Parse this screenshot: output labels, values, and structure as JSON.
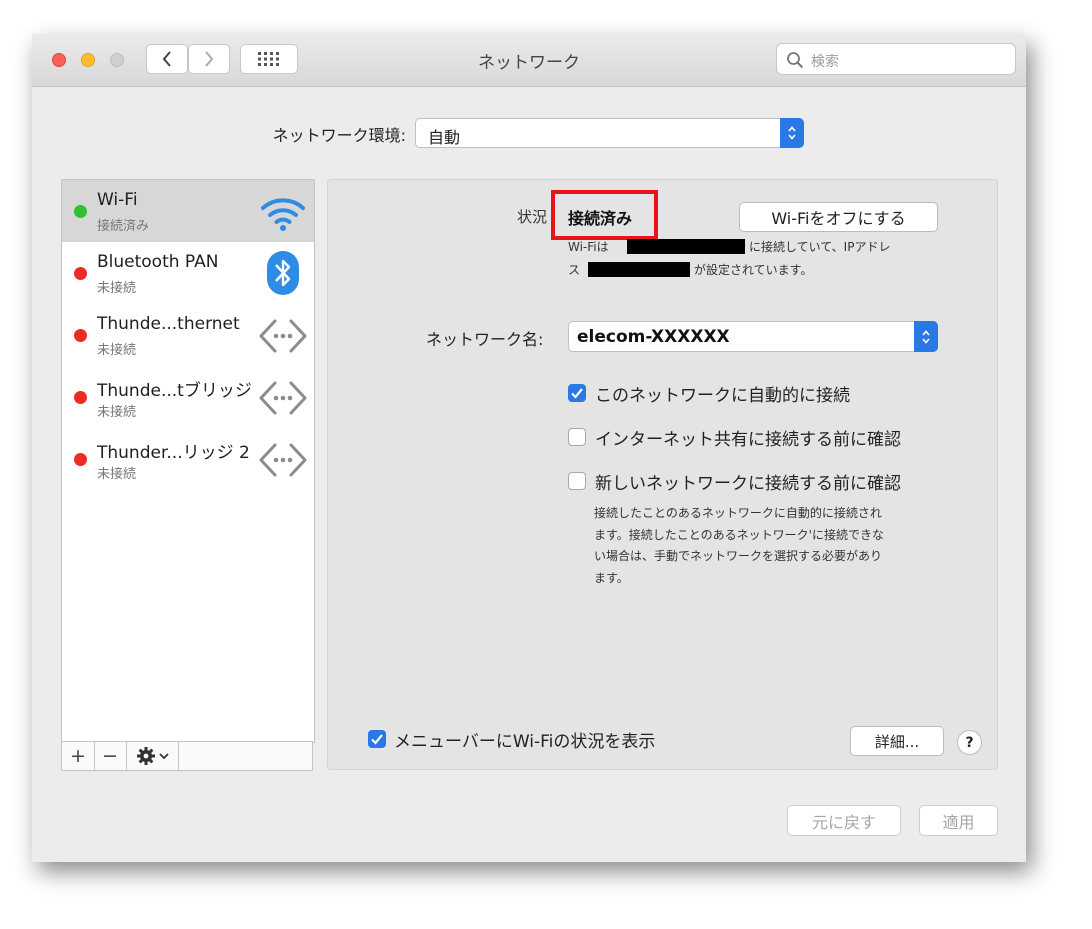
{
  "window": {
    "title": "ネットワーク",
    "search_placeholder": "検索"
  },
  "location": {
    "label": "ネットワーク環境:",
    "value": "自動"
  },
  "services": [
    {
      "name": "Wi-Fi",
      "status": "接続済み",
      "dot_color": "#2fc12f",
      "icon": "wifi-icon",
      "selected": true
    },
    {
      "name": "Bluetooth PAN",
      "status": "未接続",
      "dot_color": "#ee2a24",
      "icon": "bluetooth-icon"
    },
    {
      "name": "Thunde...thernet",
      "status": "未接続",
      "dot_color": "#ee2a24",
      "icon": "ethernet-arrows-icon"
    },
    {
      "name": "Thunde...tブリッジ",
      "status": "未接続",
      "dot_color": "#ee2a24",
      "icon": "ethernet-arrows-icon"
    },
    {
      "name": "Thunder...リッジ 2",
      "status": "未接続",
      "dot_color": "#ee2a24",
      "icon": "ethernet-arrows-icon"
    }
  ],
  "sidebar_footer": {
    "add": "+",
    "remove": "−",
    "action_icon": "gear-icon"
  },
  "detail": {
    "status_label": "状況",
    "status_value": "接続済み",
    "wifi_off_button": "Wi-Fiをオフにする",
    "info_line1_a": "Wi-Fiは",
    "info_line1_b": "に接続していて、IPアドレ",
    "info_line2_a": "ス",
    "info_line2_b": "が設定されています。",
    "network_name_label": "ネットワーク名:",
    "network_name_value": "elecom-XXXXXX",
    "checkboxes": [
      {
        "label": "このネットワークに自動的に接続",
        "checked": true
      },
      {
        "label": "インターネット共有に接続する前に確認",
        "checked": false
      },
      {
        "label": "新しいネットワークに接続する前に確認",
        "checked": false
      }
    ],
    "description": [
      "接続したことのあるネットワークに自動的に接続され",
      "ます。接続したことのあるネットワーク'に接続できな",
      "い場合は、手動でネットワークを選択する必要があり",
      "ます。"
    ],
    "menubar_checkbox": {
      "label": "メニューバーにWi-Fiの状況を表示",
      "checked": true
    },
    "advanced_button": "詳細...",
    "help_button": "?"
  },
  "bottom_buttons": {
    "revert": "元に戻す",
    "apply": "適用"
  },
  "colors": {
    "accent": "#2a78e6",
    "highlight_box": "#e8141c"
  }
}
